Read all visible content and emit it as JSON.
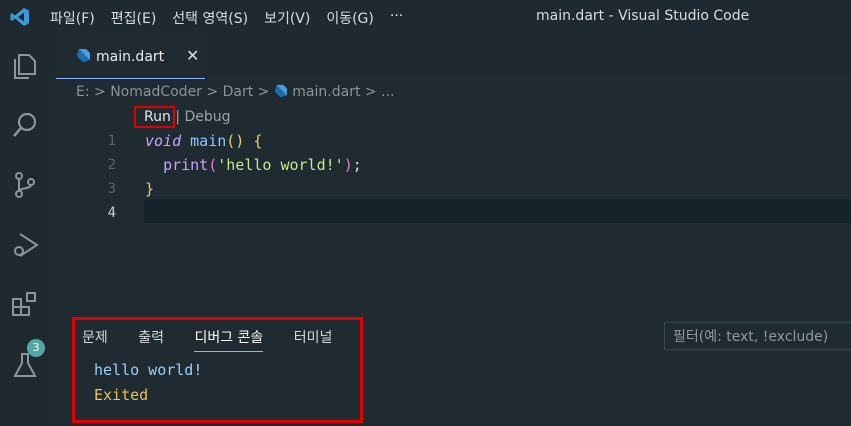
{
  "titlebar": {
    "menu": [
      "파일(F)",
      "편집(E)",
      "선택 영역(S)",
      "보기(V)",
      "이동(G)",
      "···"
    ],
    "title": "main.dart - Visual Studio Code"
  },
  "activity_bar": {
    "icons": [
      "explorer-icon",
      "search-icon",
      "source-control-icon",
      "run-debug-icon",
      "extensions-icon",
      "testing-icon"
    ],
    "extensions_badge": "3"
  },
  "tab": {
    "label": "main.dart",
    "close": "✕"
  },
  "breadcrumbs": [
    "E:",
    "NomadCoder",
    "Dart",
    "main.dart",
    "..."
  ],
  "codelens": {
    "run": "Run",
    "separator": "|",
    "debug": "Debug"
  },
  "editor": {
    "line_numbers": [
      "1",
      "2",
      "3",
      "4"
    ],
    "lines": {
      "l1_void": "void",
      "l1_name": "main",
      "l1_parens": "()",
      "l1_brace": "{",
      "l2_indent": "  ",
      "l2_print": "print",
      "l2_open": "(",
      "l2_string": "'hello world!'",
      "l2_close": ")",
      "l2_semi": ";",
      "l3_brace": "}"
    }
  },
  "panel": {
    "tabs": [
      "문제",
      "출력",
      "디버그 콘솔",
      "터미널"
    ],
    "active_tab": "디버그 콘솔",
    "filter_placeholder": "필터(예: text, !exclude)",
    "output": [
      "hello world!",
      "Exited"
    ]
  },
  "colors": {
    "highlight_box": "#e10000",
    "accent": "#8ab4ff"
  }
}
